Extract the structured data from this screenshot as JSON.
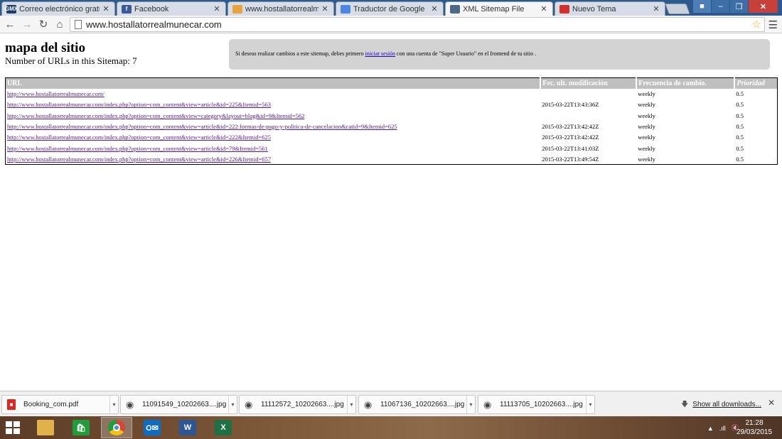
{
  "browser": {
    "tabs": [
      {
        "title": "Correo electrónico gratuit",
        "favicon": "gmx-icon",
        "favicon_text": "GMX",
        "active": false
      },
      {
        "title": "Facebook",
        "favicon": "facebook-icon",
        "favicon_text": "f",
        "active": false
      },
      {
        "title": "www.hostallatorrealmune",
        "favicon": "joomla-icon",
        "favicon_text": "",
        "active": false
      },
      {
        "title": "Traductor de Google",
        "favicon": "google-translate-icon",
        "favicon_text": "",
        "active": false
      },
      {
        "title": "XML Sitemap File",
        "favicon": "xmap-icon",
        "favicon_text": "",
        "active": true
      },
      {
        "title": "Nuevo Tema",
        "favicon": "wix-icon",
        "favicon_text": "",
        "active": false
      }
    ],
    "address": "www.hostallatorrealmunecar.com",
    "colors": {
      "tabstrip": "#2a5a8e",
      "close": "#c7413a",
      "star": "#e3b324"
    }
  },
  "page": {
    "title": "mapa del sitio",
    "url_count_text": "Number of URLs in this Sitemap: 7",
    "notice": {
      "before": "Si deseas realizar cambios a este sitemap, debes primero ",
      "link": "iniciar sesión",
      "after": " con una cuenta de \"Super Usuario\" en el frontend de tu sitio ."
    },
    "table": {
      "headers": {
        "url": "URL",
        "modified": "Fec. ult. modificación",
        "frequency": "Frecuencia de cambio.",
        "priority": "Prioridad"
      },
      "rows": [
        {
          "url": "http://www.hostallatorrealmunecar.com/",
          "modified": "",
          "frequency": "weekly",
          "priority": "0.5"
        },
        {
          "url": "http://www.hostallatorrealmunecar.com/index.php?option=com_content&view=article&id=225&Itemid=563",
          "modified": "2015-03-22T13:43:36Z",
          "frequency": "weekly",
          "priority": "0.5"
        },
        {
          "url": "http://www.hostallatorrealmunecar.com/index.php?option=com_content&view=category&layout=blog&id=9&Itemid=562",
          "modified": "",
          "frequency": "weekly",
          "priority": "0.5"
        },
        {
          "url": "http://www.hostallatorrealmunecar.com/index.php?option=com_content&view=article&id=222:formas-de-pago-y-politica-de-cancelacion&catid=9&Itemid=625",
          "modified": "2015-03-22T13:42:42Z",
          "frequency": "weekly",
          "priority": "0.5"
        },
        {
          "url": "http://www.hostallatorrealmunecar.com/index.php?option=com_content&view=article&id=222&Itemid=625",
          "modified": "2015-03-22T13:42:42Z",
          "frequency": "weekly",
          "priority": "0.5"
        },
        {
          "url": "http://www.hostallatorrealmunecar.com/index.php?option=com_content&view=article&id=79&Itemid=561",
          "modified": "2015-03-22T13:41:03Z",
          "frequency": "weekly",
          "priority": "0.5"
        },
        {
          "url": "http://www.hostallatorrealmunecar.com/index.php?option=com_content&view=article&id=226&Itemid=657",
          "modified": "2015-03-22T13:49:54Z",
          "frequency": "weekly",
          "priority": "0.5"
        }
      ]
    }
  },
  "downloads": {
    "items": [
      {
        "name": "Booking_com.pdf",
        "icon": "pdf-icon"
      },
      {
        "name": "11091549_10202663....jpg",
        "icon": "eye-icon"
      },
      {
        "name": "11112572_10202663....jpg",
        "icon": "eye-icon"
      },
      {
        "name": "11067136_10202663....jpg",
        "icon": "eye-icon"
      },
      {
        "name": "11113705_10202663....jpg",
        "icon": "eye-icon"
      }
    ],
    "show_all": "Show all downloads..."
  },
  "taskbar": {
    "apps": [
      {
        "name": "file-explorer-icon",
        "color": "#e0b34a",
        "glyph": "",
        "active": false
      },
      {
        "name": "store-icon",
        "color": "#1e9e3a",
        "glyph": "🛍",
        "active": false
      },
      {
        "name": "chrome-icon",
        "color": "#d94434",
        "glyph": "",
        "active": true
      },
      {
        "name": "outlook-icon",
        "color": "#0a6cc4",
        "glyph": "O✉",
        "active": false
      },
      {
        "name": "word-icon",
        "color": "#2b5797",
        "glyph": "W",
        "active": false
      },
      {
        "name": "excel-icon",
        "color": "#1e7145",
        "glyph": "X",
        "active": false
      }
    ],
    "time": "21:28",
    "date": "29/03/2015"
  }
}
